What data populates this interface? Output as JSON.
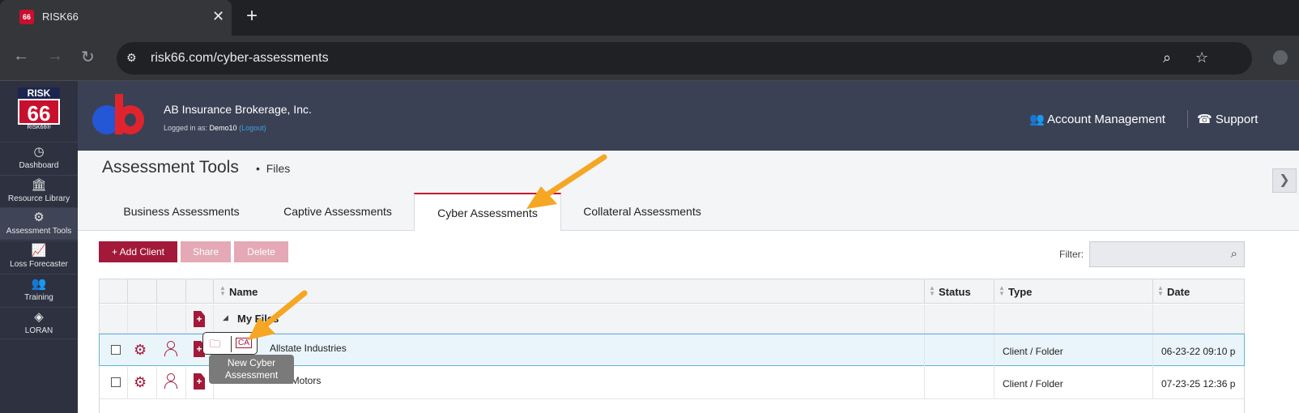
{
  "browser": {
    "tab_title": "RISK66",
    "tab_favicon": "66",
    "url": "risk66.com/cyber-assessments"
  },
  "sidebar": {
    "logo_top": "RISK",
    "logo_mid": "66",
    "logo_bot": "RISK66®",
    "items": [
      {
        "label": "Dashboard",
        "icon": "dashboard-icon"
      },
      {
        "label": "Resource Library",
        "icon": "library-icon"
      },
      {
        "label": "Assessment Tools",
        "icon": "gears-icon"
      },
      {
        "label": "Loss Forecaster",
        "icon": "chart-icon"
      },
      {
        "label": "Training",
        "icon": "training-icon"
      },
      {
        "label": "LORAN",
        "icon": "loran-icon"
      }
    ]
  },
  "header": {
    "company": "AB Insurance Brokerage, Inc.",
    "logged_in_prefix": "Logged in as: ",
    "user": "Demo10",
    "logout": "(Logout)",
    "account_management": "Account Management",
    "support": "Support"
  },
  "page": {
    "title": "Assessment Tools",
    "crumb": "Files",
    "tabs": [
      "Business Assessments",
      "Captive Assessments",
      "Cyber Assessments",
      "Collateral Assessments"
    ],
    "active_tab": "Cyber Assessments"
  },
  "toolbar": {
    "add_client": "+ Add Client",
    "share": "Share",
    "delete": "Delete",
    "filter_label": "Filter:",
    "filter_value": ""
  },
  "grid": {
    "columns": {
      "name": "Name",
      "status": "Status",
      "type": "Type",
      "date": "Date"
    },
    "folder_row": {
      "name": "My Files"
    },
    "rows": [
      {
        "name": "Allstate Industries",
        "status": "",
        "type": "Client / Folder",
        "date": "06-23-22 09:10 p"
      },
      {
        "name": "XYZ Motors",
        "status": "",
        "type": "Client / Folder",
        "date": "07-23-25 12:36 p"
      }
    ]
  },
  "tooltip": {
    "line1": "New Cyber",
    "line2": "Assessment"
  },
  "colors": {
    "brand": "#a3193a",
    "sidebar": "#2d3140",
    "header": "#3b4154",
    "arrow": "#f5a623"
  }
}
